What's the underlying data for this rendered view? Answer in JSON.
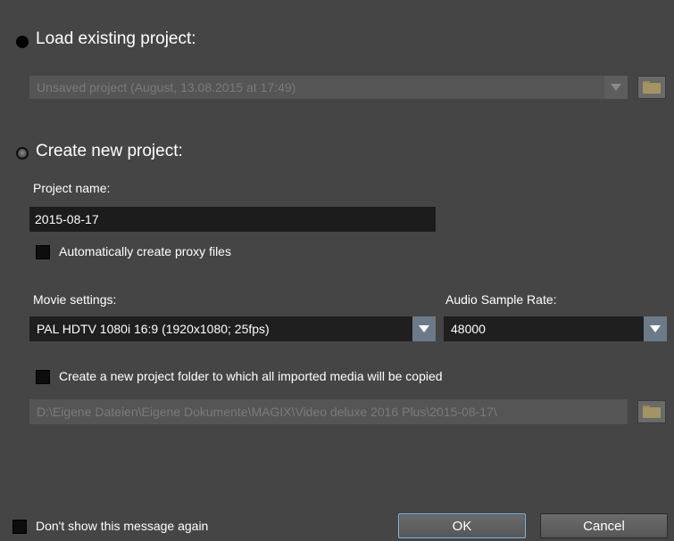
{
  "load_section": {
    "label": "Load existing project:",
    "selected_project": "Unsaved project (August, 13.08.2015 at 17:49)"
  },
  "create_section": {
    "label": "Create new project:",
    "project_name_label": "Project name:",
    "project_name_value": "2015-08-17",
    "proxy_checkbox_label": "Automatically create proxy files",
    "movie_settings_label": "Movie settings:",
    "movie_settings_value": "PAL HDTV 1080i 16:9 (1920x1080; 25fps)",
    "audio_rate_label": "Audio Sample Rate:",
    "audio_rate_value": "48000",
    "project_folder_checkbox_label": "Create a new project folder to which all imported media will be copied",
    "project_folder_path": "D:\\Eigene Dateien\\Eigene Dokumente\\MAGIX\\Video deluxe 2016 Plus\\2015-08-17\\"
  },
  "footer": {
    "dont_show_label": "Don't show this message again",
    "ok_label": "OK",
    "cancel_label": "Cancel"
  },
  "colors": {
    "background": "#454545",
    "field_dark": "#1f1f1f",
    "dropdown_accent": "#6b7a88",
    "ok_border": "#8fb3cf"
  }
}
